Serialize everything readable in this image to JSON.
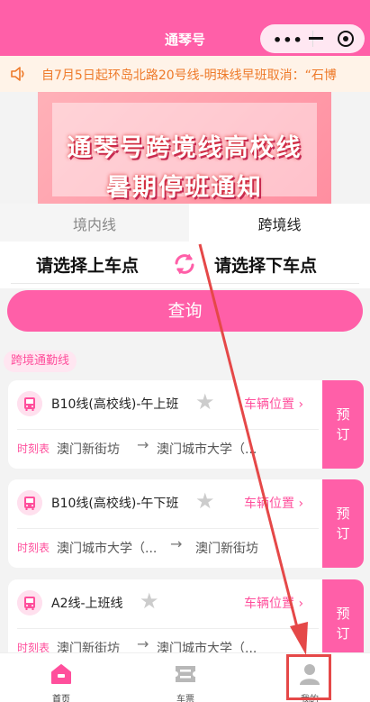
{
  "header": {
    "title": "通琴号"
  },
  "capsule": {
    "more_label": "•••"
  },
  "notice": {
    "text": "自7月5日起环岛北路20号线-明珠线早班取消：“石博"
  },
  "banner": {
    "line1": "通琴号跨境线高校线",
    "line2": "暑期停班通知"
  },
  "tabs": [
    {
      "label": "境内线"
    },
    {
      "label": "跨境线"
    }
  ],
  "selector": {
    "from": "请选择上车点",
    "to": "请选择下车点"
  },
  "query_label": "查询",
  "section_label": "跨境通勤线",
  "routes": [
    {
      "name": "B10线(高校线)-午上班",
      "location_link": "车辆位置",
      "schedule_label": "时刻表",
      "from": "澳门新街坊",
      "to": "澳门城市大学（...",
      "book_label": "预订"
    },
    {
      "name": "B10线(高校线)-午下班",
      "location_link": "车辆位置",
      "schedule_label": "时刻表",
      "from": "澳门城市大学（...",
      "to": "澳门新街坊",
      "book_label": "预订"
    },
    {
      "name": "A2线-上班线",
      "location_link": "车辆位置",
      "schedule_label": "时刻表",
      "from": "澳门新街坊",
      "to": "澳门城市大学（...",
      "book_label": "预订"
    }
  ],
  "nav": [
    {
      "label": "首页",
      "icon": "home-icon"
    },
    {
      "label": "车票",
      "icon": "ticket-icon"
    },
    {
      "label": "我的",
      "icon": "user-icon"
    }
  ],
  "colors": {
    "brand": "#ff5fa8",
    "notice_text": "#ee7a2a",
    "annotation": "#e54848"
  }
}
